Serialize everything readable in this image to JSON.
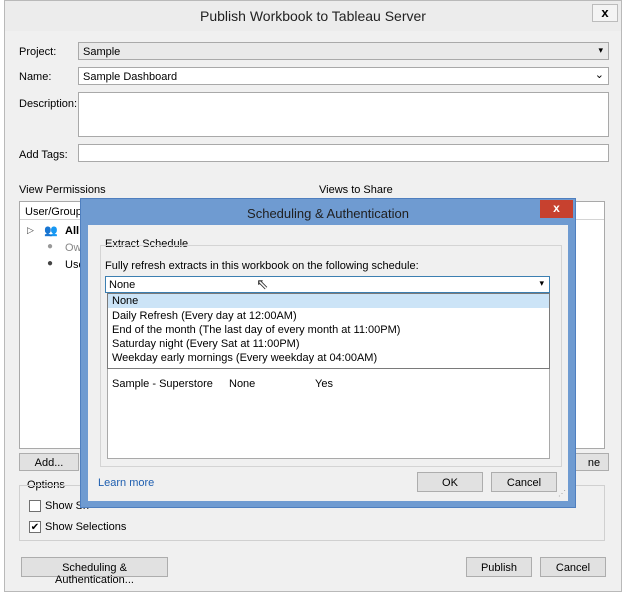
{
  "window": {
    "title": "Publish Workbook to Tableau Server",
    "close_glyph": "x"
  },
  "form": {
    "project_label": "Project:",
    "project_value": "Sample",
    "name_label": "Name:",
    "name_value": "Sample Dashboard",
    "description_label": "Description:",
    "description_value": "",
    "tags_label": "Add Tags:",
    "tags_value": ""
  },
  "permissions": {
    "label": "View Permissions",
    "column_user_group": "User/Group",
    "rows": [
      {
        "icon": "users-icon",
        "text": "All"
      },
      {
        "icon": "user-icon",
        "text": "Own"
      },
      {
        "icon": "user-icon",
        "text": "Use"
      }
    ],
    "add_button": "Add...",
    "right_button_fragment": "ne"
  },
  "views": {
    "label": "Views to Share"
  },
  "options": {
    "label": "Options",
    "show_sheets_fragment": "Show Sh",
    "show_sheets_checked": false,
    "show_selections": "Show Selections",
    "show_selections_checked": true
  },
  "footer": {
    "scheduling_button": "Scheduling & Authentication...",
    "publish_button": "Publish",
    "cancel_button": "Cancel"
  },
  "modal": {
    "title": "Scheduling & Authentication",
    "close_glyph": "x",
    "group_label": "Extract Schedule",
    "instruction": "Fully refresh extracts in this workbook on the following schedule:",
    "selected_value": "None",
    "options": [
      "None",
      "Daily Refresh (Every day at 12:00AM)",
      "End of the month (The last day of every month at 11:00PM)",
      "Saturday night (Every Sat at 11:00PM)",
      "Weekday early mornings (Every weekday at 04:00AM)"
    ],
    "table_row": {
      "datasource": "Sample - Superstore",
      "schedule": "None",
      "embed": "Yes"
    },
    "learn_more": "Learn more",
    "ok_button": "OK",
    "cancel_button": "Cancel"
  }
}
